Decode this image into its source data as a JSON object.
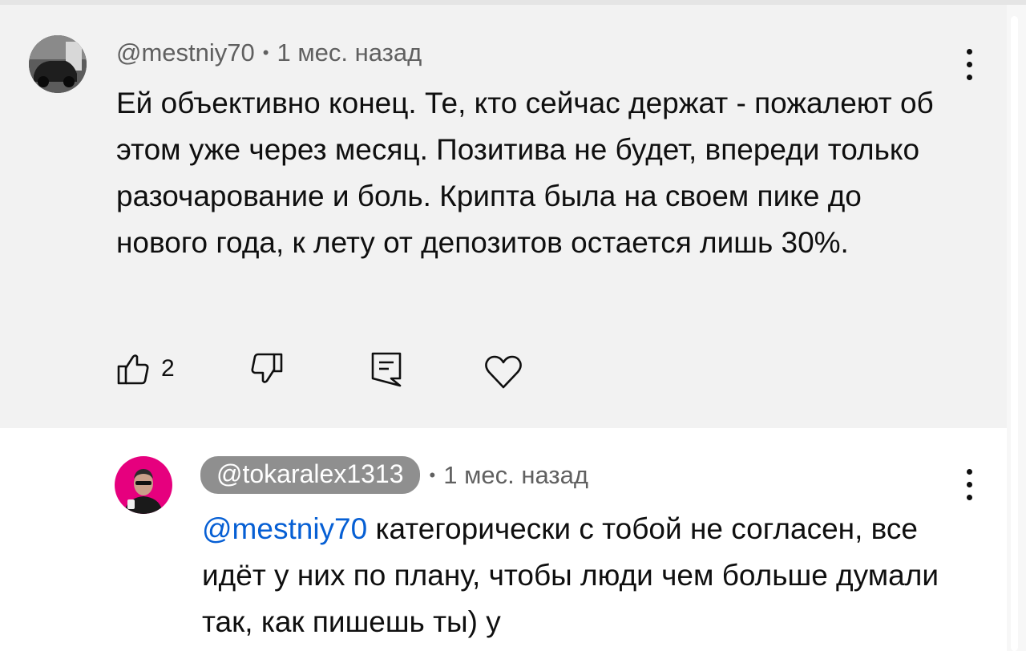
{
  "comment": {
    "author": "@mestniy70",
    "time": "1 мес. назад",
    "text": "Ей объективно конец. Те, кто сейчас держат - пожалеют об этом уже через месяц. Позитива не будет, впереди только разочарование и боль. Крипта была на своем пике до нового года, к лету от депозитов остается лишь 30%.",
    "likes": "2",
    "icons": [
      "like-icon",
      "dislike-icon",
      "reply-icon",
      "heart-icon",
      "more-icon"
    ]
  },
  "reply": {
    "author": "@tokaralex1313",
    "time": "1 мес. назад",
    "mention": "@mestniy70",
    "text": " категорически с тобой не согласен, все идёт у них по плану, чтобы люди чем больше думали так, как пишешь ты) у",
    "icons": [
      "more-icon"
    ]
  },
  "separator": "•",
  "colors": {
    "background": "#f2f2f2",
    "mention": "#065fd4",
    "chip": "#8f8f8f",
    "avatar_reply": "#e6007e"
  }
}
